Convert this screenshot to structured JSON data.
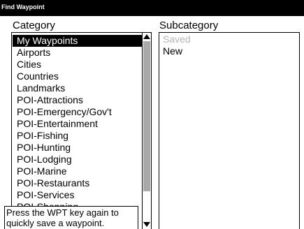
{
  "titlebar": {
    "title": "Find Waypoint"
  },
  "headers": {
    "category": "Category",
    "subcategory": "Subcategory"
  },
  "category_list": {
    "selected_index": 0,
    "items": [
      "My Waypoints",
      "Airports",
      "Cities",
      "Countries",
      "Landmarks",
      "POI-Attractions",
      "POI-Emergency/Gov't",
      "POI-Entertainment",
      "POI-Fishing",
      "POI-Hunting",
      "POI-Lodging",
      "POI-Marine",
      "POI-Restaurants",
      "POI-Services",
      "POI-Shopping"
    ]
  },
  "subcategory_list": {
    "items": [
      {
        "label": "Saved",
        "state": "disabled"
      },
      {
        "label": "New",
        "state": "enabled"
      }
    ]
  },
  "tooltip": {
    "line1": "Press the WPT key again to",
    "line2": "quickly save a waypoint."
  },
  "colors": {
    "selection_bg": "#000000",
    "disabled_text": "#b5b5b5",
    "scroll_thumb": "#a9a9a9"
  }
}
